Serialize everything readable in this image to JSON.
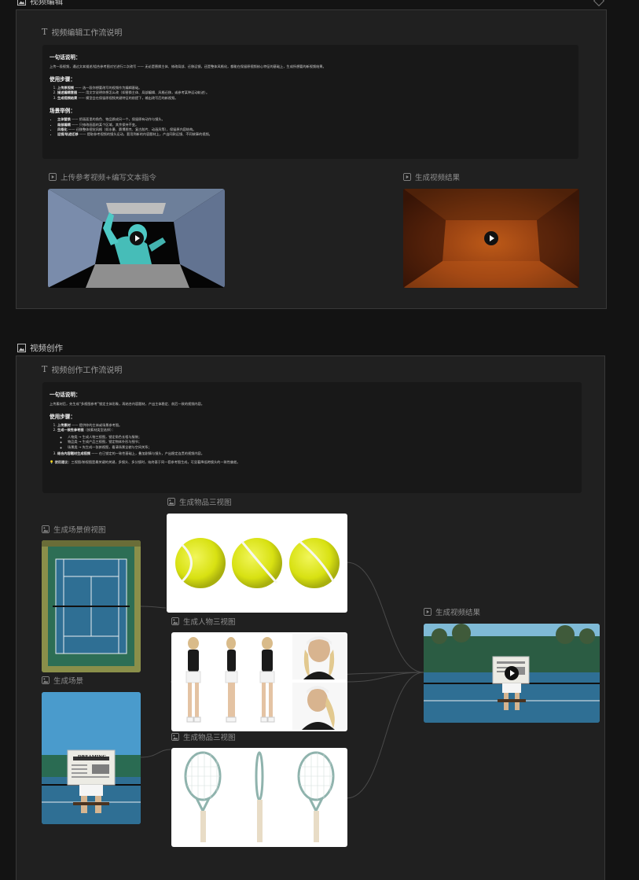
{
  "section1": {
    "label": "视频编辑",
    "workflow_title": "视频编辑工作流说明",
    "doc": {
      "h1": "一句话说明：",
      "summary": "上传一段视频，通过文本描述/组合参考图对它进行二次改写 —— 无论是替换主体、修改局部、迁移运镜，还是整体风格化，都能在保留原视频核心特征的基础上，生成所想要的新视频结果。",
      "h2": "使用步骤：",
      "steps": [
        {
          "b": "上传原视频",
          "t": " —— 选一段你想要改写的视频作为编辑基础。"
        },
        {
          "b": "描述编辑意图",
          "t": " —— 用文字说明你想怎么改（如替换主体、局部编辑、风格迁移，或参考某种运动轨迹）。"
        },
        {
          "b": "生成视频结果",
          "t": " —— 模型会在保留原视频关键特征的前提下，输出改写后的新视频。"
        }
      ],
      "h3": "场景举例：",
      "examples": [
        {
          "b": "主体替换",
          "t": " —— 把画面里的角色、物品换成另一个，保留原有动作与镜头。"
        },
        {
          "b": "局部编辑",
          "t": " —— 只修改画面的某个区域，其余保持不变。"
        },
        {
          "b": "风格化",
          "t": " —— 迁移整体视觉风格（如水墨、赛博朋克、复古胶片、动画风等），保留原内容结构。"
        },
        {
          "b": "运镜/轨迹迁移",
          "t": " —— 提取参考视频的镜头运动，套用到新的内容题材上，产出同款运镜、不同故事的视频。"
        }
      ]
    },
    "input_label": "上传参考视频+编写文本指令",
    "output_label": "生成视频结果"
  },
  "section2": {
    "label": "视频创作",
    "workflow_title": "视频创作工作流说明",
    "doc": {
      "h1": "一句话说明：",
      "summary": "上传素材后，先生成“多视图参考”锁定主体形象，再结合内容题材，产出主体稳定、前后一致的视频内容。",
      "h2": "使用步骤：",
      "steps": [
        {
          "b": "上传素材",
          "t": " —— 提供你的主体或场景参考图。"
        },
        {
          "b": "生成一致性参考图",
          "t": "（按素材类型选择）："
        }
      ],
      "sub": [
        "人物类 → 生成人物三视图，锁定角色长相与服装；",
        "物品类 → 生成产品三视图，锁定物体外形与细节；",
        "场景类 → 先生成一张俯视图，看清场景全貌与空间关系；"
      ],
      "step3": {
        "b": "结合内容题材生成视频",
        "t": " —— 在已锁定的一致性基础上，叠加剧情与镜头，产出稳定连贯的视频内容。"
      },
      "tip_b": "使用建议：",
      "tip": "三视图/俯视图是最关键的关键，多镜头、多分镜时，始终基于同一套参考图生成，可显著降低跨镜头的一致性偏差。"
    },
    "labels": {
      "item_views_top": "生成物品三视图",
      "scene_top": "生成场景俯视图",
      "person_views": "生成人物三视图",
      "item_views_bottom": "生成物品三视图",
      "scene": "生成场景",
      "result": "生成视频结果"
    },
    "newspaper_headline": "DREAMING"
  },
  "colors": {
    "tennis_ball": "#dde51a",
    "court_blue": "#2f6f94",
    "court_green": "#2d6e55"
  }
}
